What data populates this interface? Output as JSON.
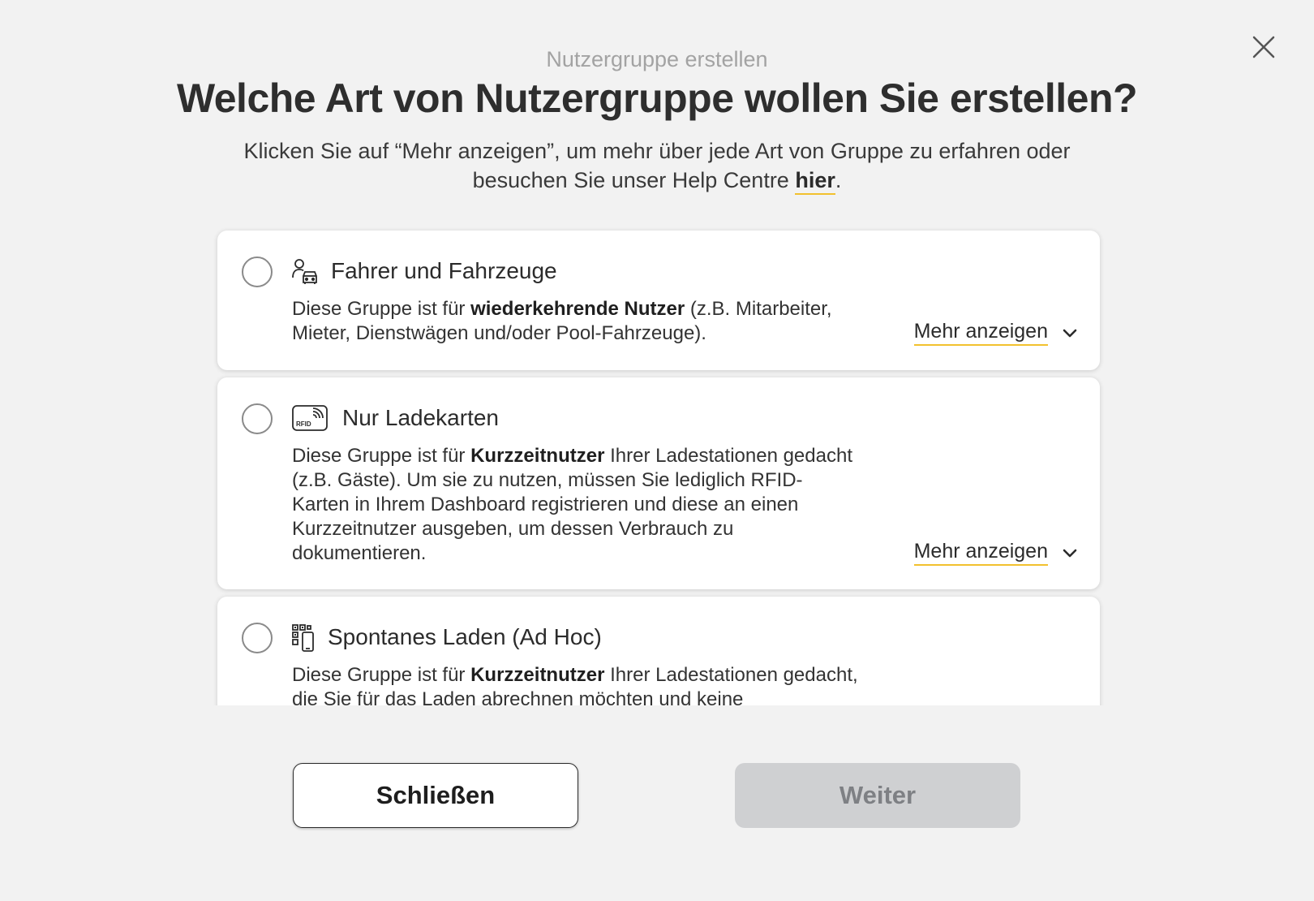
{
  "dialog": {
    "eyebrow": "Nutzergruppe erstellen",
    "title": "Welche Art von Nutzergruppe wollen Sie erstellen?",
    "subtitle_prefix": "Klicken Sie auf “Mehr anzeigen”, um mehr über jede Art von Gruppe zu erfahren oder besuchen Sie unser Help Centre ",
    "subtitle_link": "hier",
    "subtitle_suffix": ".",
    "close_icon": "close-icon"
  },
  "options": [
    {
      "title": "Fahrer und Fahrzeuge",
      "icon": "driver-car-icon",
      "desc_pre": "Diese Gruppe ist für ",
      "desc_bold": "wiederkehrende Nutzer",
      "desc_post": " (z.B. Mitarbeiter, Mieter, Dienstwägen und/oder Pool-Fahrzeuge).",
      "more_label": "Mehr anzeigen",
      "selected": false
    },
    {
      "title": "Nur Ladekarten",
      "icon": "rfid-card-icon",
      "icon_text": "RFID",
      "desc_pre": "Diese Gruppe ist für ",
      "desc_bold": "Kurzzeitnutzer",
      "desc_post": " Ihrer Ladestationen gedacht (z.B. Gäste). Um sie zu nutzen, müssen Sie lediglich RFID-Karten in Ihrem Dashboard registrieren und diese an einen Kurzzeitnutzer ausgeben, um dessen Verbrauch zu dokumentieren.",
      "more_label": "Mehr anzeigen",
      "selected": false
    },
    {
      "title": "Spontanes Laden (Ad Hoc)",
      "icon": "qr-phone-icon",
      "desc_pre": "Diese Gruppe ist für ",
      "desc_bold": "Kurzzeitnutzer",
      "desc_post": " Ihrer Ladestationen gedacht, die Sie für das Laden abrechnen möchten und keine",
      "selected": false
    }
  ],
  "footer": {
    "close_label": "Schließen",
    "next_label": "Weiter",
    "next_disabled": true
  },
  "colors": {
    "accent_underline": "#f2c12e",
    "background": "#f2f2f2",
    "disabled_button": "#cfd0d2"
  }
}
